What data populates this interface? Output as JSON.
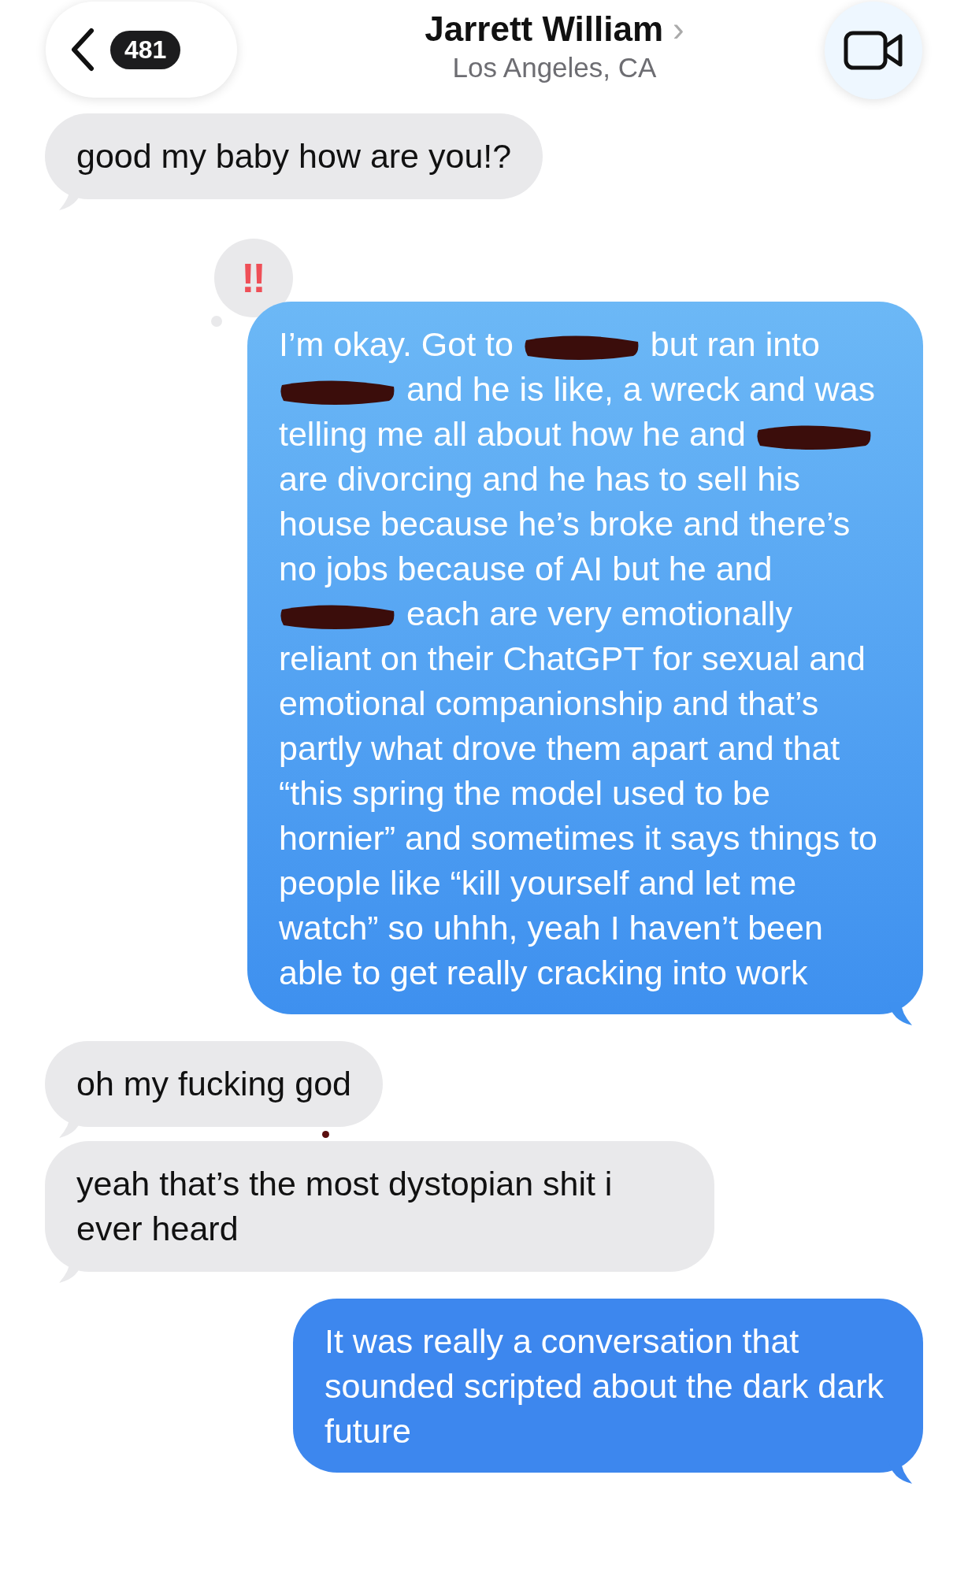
{
  "header": {
    "back_count": "481",
    "contact_name": "Jarrett William",
    "chevron": "›",
    "location": "Los Angeles, CA"
  },
  "messages": [
    {
      "kind": "received",
      "parts": [
        {
          "kind": "text",
          "text": "good my baby how are you!?"
        }
      ]
    },
    {
      "kind": "sent",
      "reaction": "‼",
      "parts": [
        {
          "kind": "text",
          "text": "I’m okay. Got to "
        },
        {
          "kind": "redaction"
        },
        {
          "kind": "text",
          "text": " but ran into "
        },
        {
          "kind": "redaction"
        },
        {
          "kind": "text",
          "text": " and he is like, a wreck and was telling me all about how he and "
        },
        {
          "kind": "redaction"
        },
        {
          "kind": "text",
          "text": " are divorcing and he has to sell his house because he’s broke and there’s no jobs because of AI but he and "
        },
        {
          "kind": "redaction"
        },
        {
          "kind": "text",
          "text": " each are very emotionally reliant on their ChatGPT for sexual and emotional companionship and that’s partly what drove them apart and that “this spring the model used to be hornier” and sometimes it says things to people like “kill yourself and let me watch” so uhhh, yeah I haven’t been able to get really cracking into work"
        }
      ]
    },
    {
      "kind": "received",
      "dot": true,
      "parts": [
        {
          "kind": "text",
          "text": "oh my fucking god"
        }
      ]
    },
    {
      "kind": "received",
      "parts": [
        {
          "kind": "text",
          "text": "yeah that’s the most dystopian shit i ever heard"
        }
      ]
    },
    {
      "kind": "sent",
      "parts": [
        {
          "kind": "text",
          "text": "It was really a conversation that sounded scripted about the dark dark future"
        }
      ]
    }
  ]
}
